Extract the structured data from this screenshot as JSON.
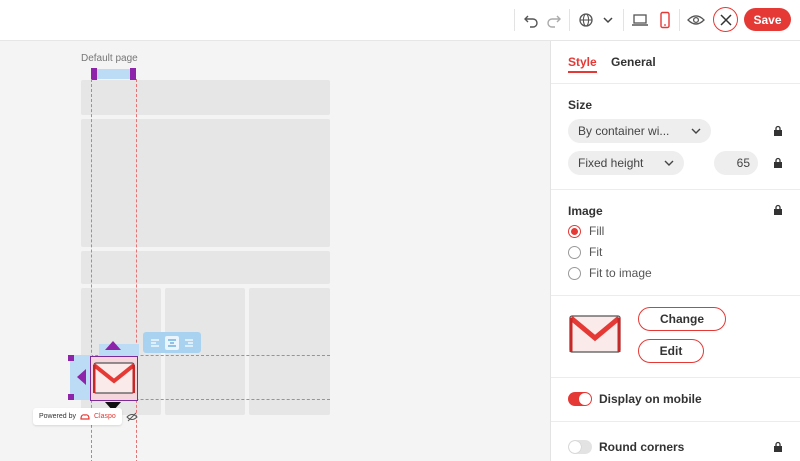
{
  "toolbar": {
    "save_label": "Save",
    "icons": [
      "undo-icon",
      "redo-icon",
      "globe-icon",
      "chevron-down-icon",
      "laptop-icon",
      "mobile-icon",
      "eye-icon",
      "close-icon"
    ]
  },
  "canvas": {
    "page_label": "Default page",
    "powered_by": "Powered by",
    "brand": "Claspo"
  },
  "panel": {
    "tabs": [
      {
        "label": "Style",
        "active": true
      },
      {
        "label": "General",
        "active": false
      }
    ],
    "size": {
      "title": "Size",
      "width_mode": "By container wi...",
      "height_mode": "Fixed height",
      "height_value": "65"
    },
    "image": {
      "title": "Image",
      "options": [
        {
          "label": "Fill",
          "selected": true
        },
        {
          "label": "Fit",
          "selected": false
        },
        {
          "label": "Fit to image",
          "selected": false
        }
      ],
      "change_label": "Change",
      "edit_label": "Edit"
    },
    "display_on_mobile": {
      "label": "Display on mobile",
      "on": true
    },
    "round_corners": {
      "label": "Round corners",
      "on": false
    }
  },
  "colors": {
    "accent": "#e53935",
    "selection": "#7b2a99",
    "guide": "#e57373",
    "toolbar_highlight": "#a9d2f0"
  }
}
